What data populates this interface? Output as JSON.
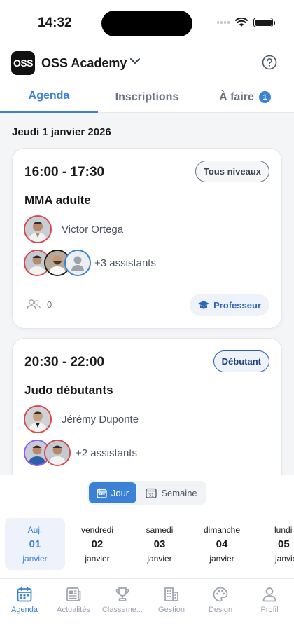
{
  "status": {
    "time": "14:32"
  },
  "header": {
    "logo_text": "OSS",
    "org_name": "OSS Academy"
  },
  "tabs": {
    "agenda": "Agenda",
    "inscriptions": "Inscriptions",
    "afaire": "À faire",
    "afaire_badge": "1"
  },
  "date_heading": "Jeudi 1 janvier 2026",
  "sessions": [
    {
      "time": "16:00 - 17:30",
      "level": "Tous niveaux",
      "class_name": "MMA adulte",
      "teacher": "Victor Ortega",
      "assistants": "+3 assistants",
      "participants": "0",
      "role": "Professeur"
    },
    {
      "time": "20:30 - 22:00",
      "level": "Débutant",
      "class_name": "Judo débutants",
      "teacher": "Jérémy Duponte",
      "assistants": "+2 assistants"
    }
  ],
  "view_toggle": {
    "day": "Jour",
    "week": "Semaine",
    "week_icon_num": "31"
  },
  "days": [
    {
      "name": "Auj.",
      "num": "01",
      "month": "janvier",
      "selected": true
    },
    {
      "name": "vendredi",
      "num": "02",
      "month": "janvier"
    },
    {
      "name": "samedi",
      "num": "03",
      "month": "janvier"
    },
    {
      "name": "dimanche",
      "num": "04",
      "month": "janvier"
    },
    {
      "name": "lundi",
      "num": "05",
      "month": "janvier"
    }
  ],
  "tabbar": [
    {
      "label": "Agenda",
      "icon": "calendar-icon",
      "active": true
    },
    {
      "label": "Actualités",
      "icon": "newspaper-icon"
    },
    {
      "label": "Classeme...",
      "icon": "trophy-icon"
    },
    {
      "label": "Gestion",
      "icon": "building-icon"
    },
    {
      "label": "Design",
      "icon": "palette-icon"
    },
    {
      "label": "Profil",
      "icon": "person-icon"
    }
  ],
  "colors": {
    "accent": "#3b82d6",
    "avatar_ring_red": "#d94848",
    "avatar_ring_blue": "#3b82d6",
    "avatar_ring_purple": "#8b5cf6"
  }
}
